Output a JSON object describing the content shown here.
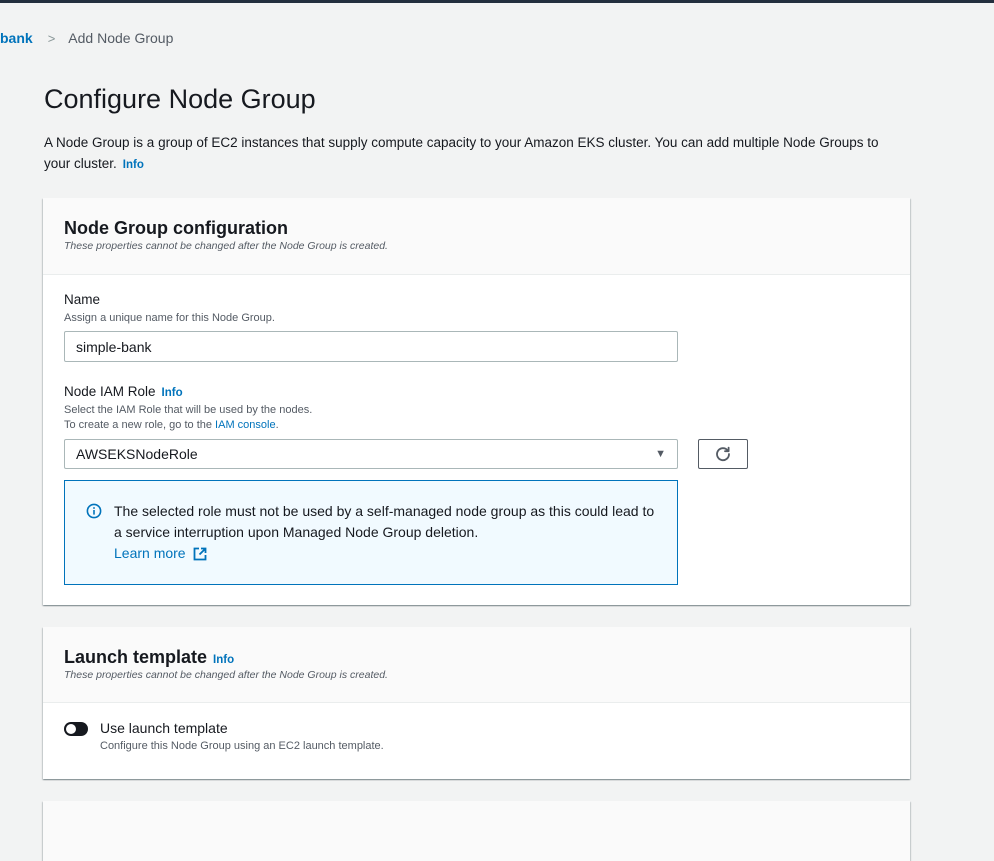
{
  "breadcrumb": {
    "parent": "bank",
    "separator": ">",
    "current": "Add Node Group"
  },
  "page": {
    "title": "Configure Node Group",
    "description": "A Node Group is a group of EC2 instances that supply compute capacity to your Amazon EKS cluster. You can add multiple Node Groups to your cluster.",
    "info": "Info"
  },
  "node_group_config": {
    "title": "Node Group configuration",
    "subtitle": "These properties cannot be changed after the Node Group is created.",
    "name": {
      "label": "Name",
      "description": "Assign a unique name for this Node Group.",
      "value": "simple-bank"
    },
    "iam_role": {
      "label": "Node IAM Role",
      "info": "Info",
      "description_line1": "Select the IAM Role that will be used by the nodes.",
      "description_line2_prefix": "To create a new role, go to the ",
      "description_link": "IAM console",
      "description_line2_suffix": ".",
      "selected": "AWSEKSNodeRole",
      "refresh_icon": "refresh-icon"
    },
    "alert": {
      "icon": "info-circle-icon",
      "message": "The selected role must not be used by a self-managed node group as this could lead to a service interruption upon Managed Node Group deletion.",
      "link": "Learn more",
      "link_icon": "external-link-icon"
    }
  },
  "launch_template": {
    "title": "Launch template",
    "info": "Info",
    "subtitle": "These properties cannot be changed after the Node Group is created.",
    "toggle_label": "Use launch template",
    "toggle_description": "Configure this Node Group using an EC2 launch template.",
    "toggle_on": false
  },
  "colors": {
    "link": "#0073bb",
    "alert_bg": "#f1faff",
    "alert_border": "#0073bb",
    "page_bg": "#f2f3f3",
    "header_bar": "#232f3e"
  }
}
